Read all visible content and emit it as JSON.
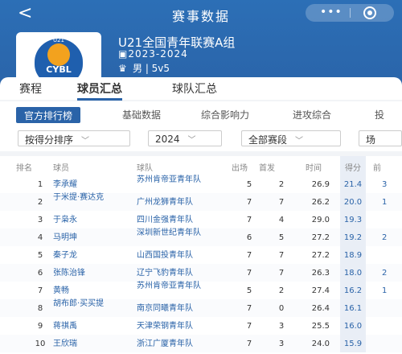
{
  "topbar": {
    "back": "<",
    "title": "赛事数据",
    "more": "•••"
  },
  "league": {
    "logo_text": "CYBL",
    "logo_top": "U21",
    "name": "U21全国青年联赛A组",
    "season": "2023-2024",
    "meta": "男 | 5v5"
  },
  "main_tabs": [
    "赛程",
    "球员汇总",
    "球队汇总"
  ],
  "sub_tabs": [
    "官方排行榜",
    "基础数据",
    "综合影响力",
    "进攻综合",
    "投"
  ],
  "filters": {
    "sort": "按得分排序",
    "year": "2024",
    "stage": "全部赛段",
    "extra": "场"
  },
  "columns": {
    "rank": "排名",
    "player": "球员",
    "team": "球队",
    "apps": "出场",
    "starts": "首发",
    "time": "时间",
    "pts": "得分",
    "extra": "前"
  },
  "rows": [
    {
      "rank": "1",
      "player": "李承耀",
      "team": "苏州肯帝亚青年队",
      "apps": "5",
      "starts": "2",
      "time": "26.9",
      "pts": "21.4",
      "extra": "3"
    },
    {
      "rank": "2",
      "player": "于米提·赛达克",
      "team": "广州龙狮青年队",
      "apps": "7",
      "starts": "7",
      "time": "26.2",
      "pts": "20.0",
      "extra": "1"
    },
    {
      "rank": "3",
      "player": "于枭永",
      "team": "四川金强青年队",
      "apps": "7",
      "starts": "4",
      "time": "29.0",
      "pts": "19.3",
      "extra": ""
    },
    {
      "rank": "4",
      "player": "马明坤",
      "team": "深圳新世纪青年队",
      "apps": "6",
      "starts": "5",
      "time": "27.2",
      "pts": "19.2",
      "extra": "2"
    },
    {
      "rank": "5",
      "player": "秦子龙",
      "team": "山西国投青年队",
      "apps": "7",
      "starts": "7",
      "time": "27.2",
      "pts": "18.9",
      "extra": ""
    },
    {
      "rank": "6",
      "player": "张陈治锋",
      "team": "辽宁飞豹青年队",
      "apps": "7",
      "starts": "7",
      "time": "26.3",
      "pts": "18.0",
      "extra": "2"
    },
    {
      "rank": "7",
      "player": "黄畅",
      "team": "苏州肯帝亚青年队",
      "apps": "5",
      "starts": "2",
      "time": "27.4",
      "pts": "16.2",
      "extra": "1"
    },
    {
      "rank": "8",
      "player": "胡布郎·买买提",
      "team": "南京同曦青年队",
      "apps": "7",
      "starts": "0",
      "time": "26.4",
      "pts": "16.1",
      "extra": ""
    },
    {
      "rank": "9",
      "player": "蒋祺禹",
      "team": "天津荣钢青年队",
      "apps": "7",
      "starts": "3",
      "time": "25.5",
      "pts": "16.0",
      "extra": ""
    },
    {
      "rank": "10",
      "player": "王欣瑞",
      "team": "浙江广厦青年队",
      "apps": "7",
      "starts": "3",
      "time": "24.0",
      "pts": "15.9",
      "extra": ""
    }
  ]
}
